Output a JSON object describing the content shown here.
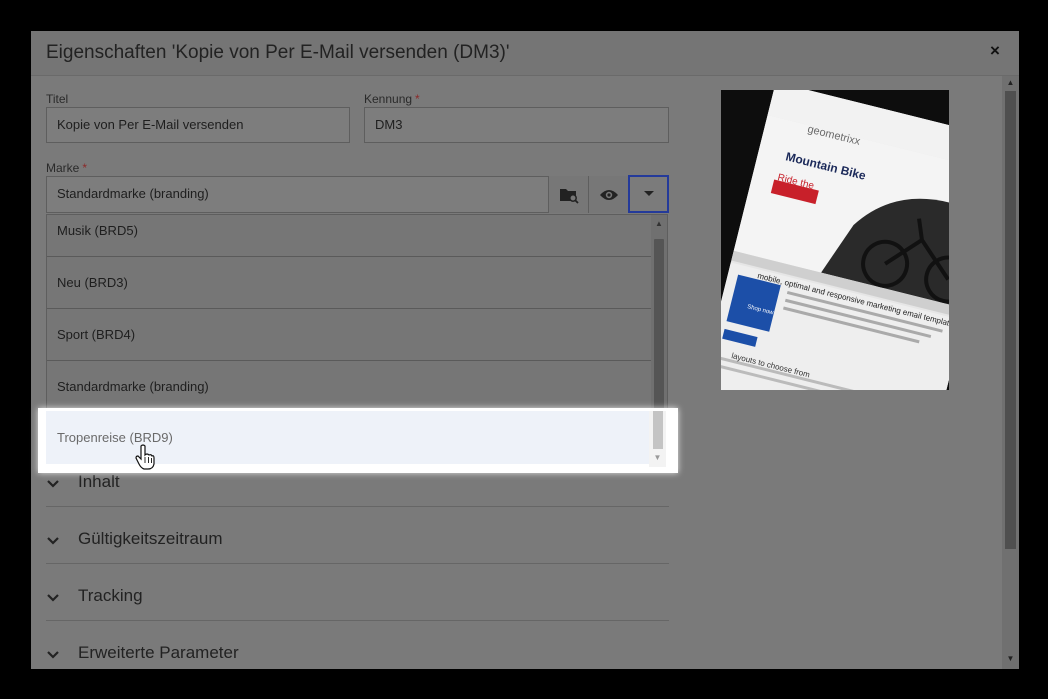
{
  "dialog": {
    "title": "Eigenschaften 'Kopie von Per E-Mail versenden (DM3)'",
    "close_label": "×"
  },
  "form": {
    "title_label": "Titel",
    "title_value": "Kopie von Per E-Mail versenden",
    "id_label": "Kennung",
    "id_value": "DM3",
    "brand_label": "Marke",
    "required_mark": "*",
    "brand_value": "Standardmarke (branding)"
  },
  "dropdown": {
    "items": [
      {
        "label": "Musik (BRD5)"
      },
      {
        "label": "Neu (BRD3)"
      },
      {
        "label": "Sport (BRD4)"
      },
      {
        "label": "Standardmarke (branding)"
      }
    ],
    "hovered_item": "Tropenreise (BRD9)"
  },
  "sections": [
    {
      "label": "Inhalt"
    },
    {
      "label": "Gültigkeitszeitraum"
    },
    {
      "label": "Tracking"
    },
    {
      "label": "Erweiterte Parameter"
    }
  ],
  "preview": {
    "brand_text": "geometrixx",
    "headline": "Mountain Bike",
    "tagline_1": "Ride the",
    "body_text": "mobile, optimal and responsive marketing email template",
    "button_text": "Shop now",
    "footer_text": "layouts to choose from"
  },
  "colors": {
    "overlay_bg": "#7a7a7a",
    "focus_border": "#243a9a",
    "required": "#8c2a2a",
    "highlight_bg": "#eef2f9",
    "preview_accent": "#c8202a",
    "preview_link": "#1c4fa8"
  }
}
